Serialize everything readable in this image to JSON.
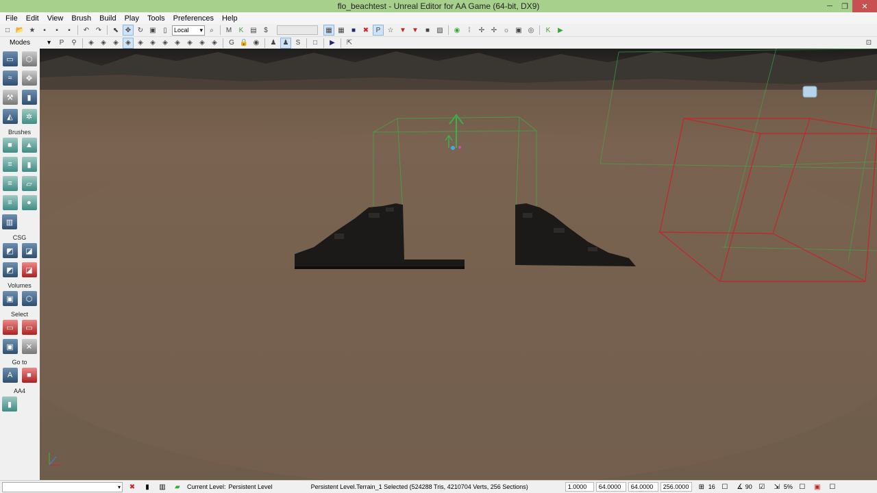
{
  "window": {
    "title": "flo_beachtest - Unreal Editor for AA Game (64-bit, DX9)",
    "minimize": "─",
    "restore": "❐",
    "close": "✕"
  },
  "menu": [
    "File",
    "Edit",
    "View",
    "Brush",
    "Build",
    "Play",
    "Tools",
    "Preferences",
    "Help"
  ],
  "toolbar": {
    "coord_system": "Local"
  },
  "modes": {
    "label": "Modes",
    "sections": {
      "brushes": "Brushes",
      "csg": "CSG",
      "volumes": "Volumes",
      "select": "Select",
      "goto": "Go to",
      "aa4": "AA4"
    }
  },
  "status": {
    "current_level_label": "Current Level:",
    "current_level_value": "Persistent Level",
    "selection": "Persistent Level.Terrain_1 Selected (524288 Tris, 4210704 Verts, 256 Sections)",
    "drag_grid": "1.0000",
    "rot_grid": "64.0000",
    "scale_grid": "64.0000",
    "dist": "256.0000",
    "grid_size": "16",
    "rot_snap": "90",
    "scale_snap": "5%"
  },
  "colors": {
    "titlebar": "#a8d08d",
    "close_button": "#c75050",
    "terrain": "#75604e",
    "green_brush": "#3cb04a",
    "red_brush": "#c0282e"
  }
}
